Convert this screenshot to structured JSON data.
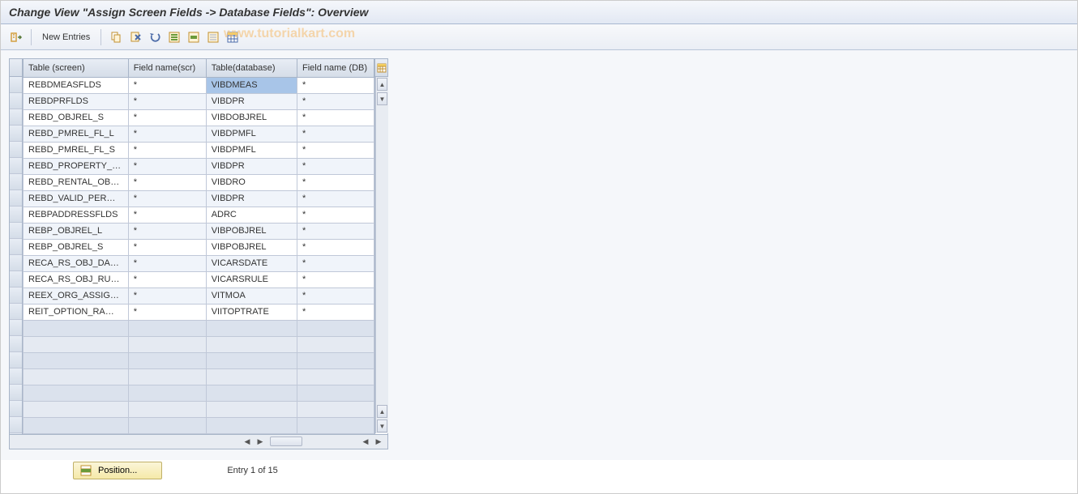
{
  "header": {
    "title": "Change View \"Assign Screen Fields -> Database Fields\": Overview"
  },
  "toolbar": {
    "new_entries_label": "New Entries",
    "watermark": "www.tutorialkart.com"
  },
  "table": {
    "columns": {
      "table_screen": "Table (screen)",
      "field_name_scr": "Field name(scr)",
      "table_database": "Table(database)",
      "field_name_db": "Field name (DB)"
    },
    "rows": [
      {
        "table_screen": "REBDMEASFLDS",
        "field_name_scr": "*",
        "table_database": "VIBDMEAS",
        "field_name_db": "*",
        "selected": true
      },
      {
        "table_screen": "REBDPRFLDS",
        "field_name_scr": "*",
        "table_database": "VIBDPR",
        "field_name_db": "*"
      },
      {
        "table_screen": "REBD_OBJREL_S",
        "field_name_scr": "*",
        "table_database": "VIBDOBJREL",
        "field_name_db": "*"
      },
      {
        "table_screen": "REBD_PMREL_FL_L",
        "field_name_scr": "*",
        "table_database": "VIBDPMFL",
        "field_name_db": "*"
      },
      {
        "table_screen": "REBD_PMREL_FL_S",
        "field_name_scr": "*",
        "table_database": "VIBDPMFL",
        "field_name_db": "*"
      },
      {
        "table_screen": "REBD_PROPERTY_…",
        "field_name_scr": "*",
        "table_database": "VIBDPR",
        "field_name_db": "*"
      },
      {
        "table_screen": "REBD_RENTAL_OB…",
        "field_name_scr": "*",
        "table_database": "VIBDRO",
        "field_name_db": "*"
      },
      {
        "table_screen": "REBD_VALID_PER…",
        "field_name_scr": "*",
        "table_database": "VIBDPR",
        "field_name_db": "*"
      },
      {
        "table_screen": "REBPADDRESSFLDS",
        "field_name_scr": "*",
        "table_database": "ADRC",
        "field_name_db": "*"
      },
      {
        "table_screen": "REBP_OBJREL_L",
        "field_name_scr": "*",
        "table_database": "VIBPOBJREL",
        "field_name_db": "*"
      },
      {
        "table_screen": "REBP_OBJREL_S",
        "field_name_scr": "*",
        "table_database": "VIBPOBJREL",
        "field_name_db": "*"
      },
      {
        "table_screen": "RECA_RS_OBJ_DA…",
        "field_name_scr": "*",
        "table_database": "VICARSDATE",
        "field_name_db": "*"
      },
      {
        "table_screen": "RECA_RS_OBJ_RU…",
        "field_name_scr": "*",
        "table_database": "VICARSRULE",
        "field_name_db": "*"
      },
      {
        "table_screen": "REEX_ORG_ASSIG…",
        "field_name_scr": "*",
        "table_database": "VITMOA",
        "field_name_db": "*"
      },
      {
        "table_screen": "REIT_OPTION_RA…",
        "field_name_scr": "*",
        "table_database": "VIITOPTRATE",
        "field_name_db": "*"
      }
    ],
    "empty_rows": 7
  },
  "footer": {
    "position_label": "Position...",
    "entry_text": "Entry 1 of 15"
  }
}
